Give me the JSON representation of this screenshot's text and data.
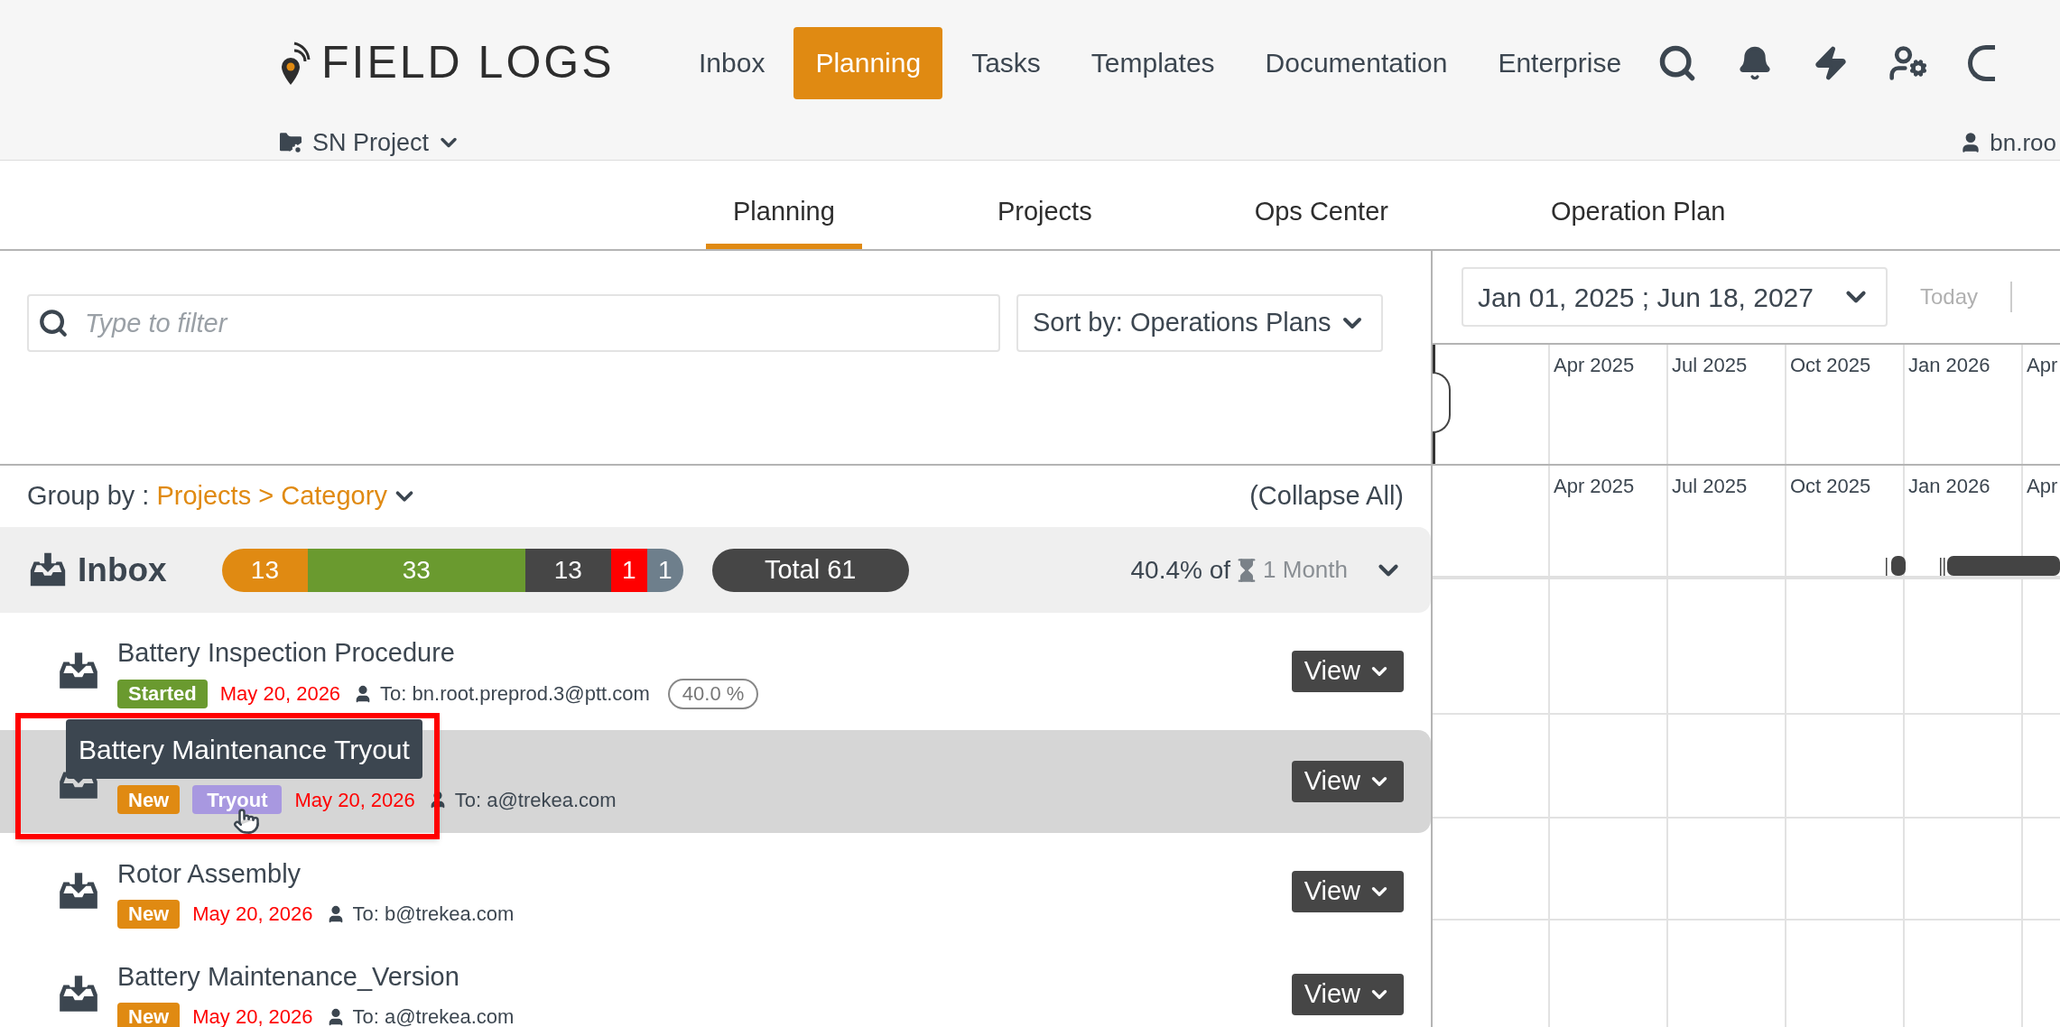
{
  "header": {
    "logo": "FIELD LOGS",
    "project": "SN Project",
    "user": "bn.roo",
    "nav": [
      {
        "label": "Inbox",
        "selected": false
      },
      {
        "label": "Planning",
        "selected": true
      },
      {
        "label": "Tasks",
        "selected": false
      },
      {
        "label": "Templates",
        "selected": false
      },
      {
        "label": "Documentation",
        "selected": false
      },
      {
        "label": "Enterprise",
        "selected": false
      }
    ]
  },
  "subnav": [
    {
      "label": "Planning",
      "selected": true
    },
    {
      "label": "Projects",
      "selected": false
    },
    {
      "label": "Ops Center",
      "selected": false
    },
    {
      "label": "Operation Plan",
      "selected": false
    }
  ],
  "filter": {
    "placeholder": "Type to filter"
  },
  "sort": "Sort by: Operations Plans",
  "group_by": {
    "label": "Group by :",
    "value": "Projects > Category"
  },
  "collapse_all": "(Collapse All)",
  "group": {
    "title": "Inbox",
    "total": "Total 61",
    "progress": "40.4% of",
    "duration": "1 Month",
    "counts": [
      {
        "value": "13",
        "color": "#e08a12"
      },
      {
        "value": "33",
        "color": "#6a9a2f"
      },
      {
        "value": "13",
        "color": "#464646"
      },
      {
        "value": "1",
        "color": "#ff0000"
      },
      {
        "value": "1",
        "color": "#6e7f8c"
      }
    ]
  },
  "items": [
    {
      "title": "Battery Inspection Procedure",
      "selected": false,
      "status": {
        "label": "Started",
        "color": "#6a9a2f"
      },
      "date": "May 20, 2026",
      "assignee": "To: bn.root.preprod.3@ptt.com",
      "percent": "40.0 %",
      "button": "View"
    },
    {
      "selected": true,
      "tooltip": "Battery Maintenance Tryout",
      "status": {
        "label": "New",
        "color": "#e08a12"
      },
      "tag": "Tryout",
      "date": "May 20, 2026",
      "assignee": "To: a@trekea.com",
      "button": "View"
    },
    {
      "title": "Rotor Assembly",
      "selected": false,
      "status": {
        "label": "New",
        "color": "#e08a12"
      },
      "date": "May 20, 2026",
      "assignee": "To: b@trekea.com",
      "button": "View"
    },
    {
      "title": "Battery Maintenance_Version",
      "selected": false,
      "status": {
        "label": "New",
        "color": "#e08a12"
      },
      "date": "May 20, 2026",
      "assignee": "To: a@trekea.com",
      "button": "View"
    }
  ],
  "timeline": {
    "date_range": "Jan 01, 2025 ; Jun 18, 2027",
    "today": "Today",
    "months_top": [
      "Apr 2025",
      "Jul 2025",
      "Oct 2025",
      "Jan 2026",
      "Apr"
    ],
    "months_bottom": [
      "Apr 2025",
      "Jul 2025",
      "Oct 2025",
      "Jan 2026",
      "Apr"
    ]
  }
}
